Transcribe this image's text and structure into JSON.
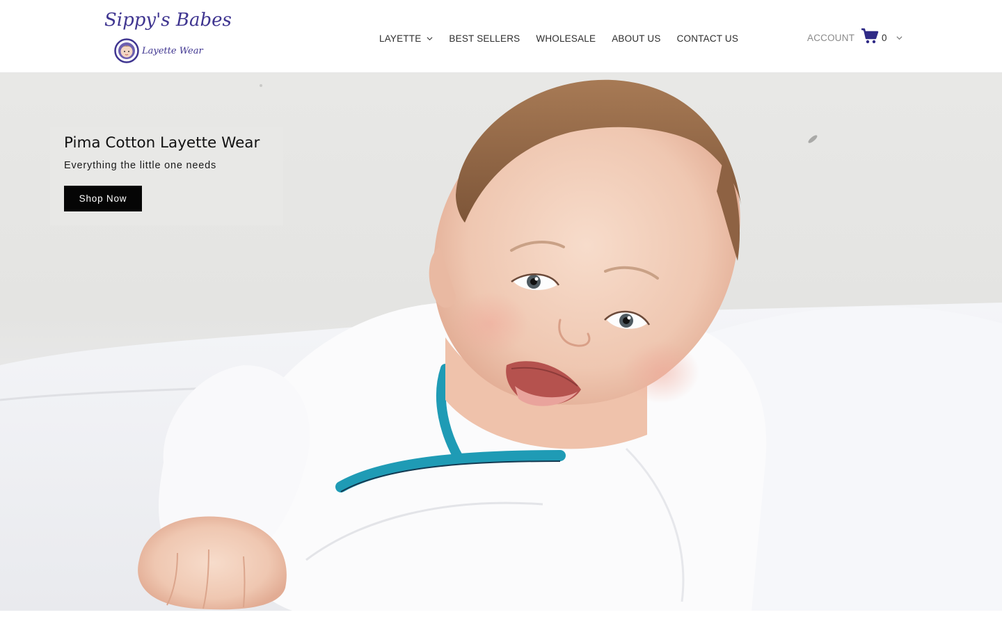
{
  "brand": {
    "logo_title": "Sippy's Babes",
    "logo_subtitle": "Layette Wear",
    "color": "#3f3590"
  },
  "nav": {
    "items": [
      {
        "label": "LAYETTE",
        "has_dropdown": true
      },
      {
        "label": "BEST SELLERS"
      },
      {
        "label": "WHOLESALE"
      },
      {
        "label": "ABOUT US"
      },
      {
        "label": "CONTACT US"
      }
    ]
  },
  "header_right": {
    "account_label": "ACCOUNT",
    "cart_count": "0",
    "cart_icon": "shopping-cart-icon",
    "cart_icon_color": "#2f2a86"
  },
  "hero": {
    "title": "Pima Cotton Layette Wear",
    "subtitle": "Everything the little one needs",
    "button_label": "Shop Now",
    "image_subject": "smiling-baby-photo"
  }
}
